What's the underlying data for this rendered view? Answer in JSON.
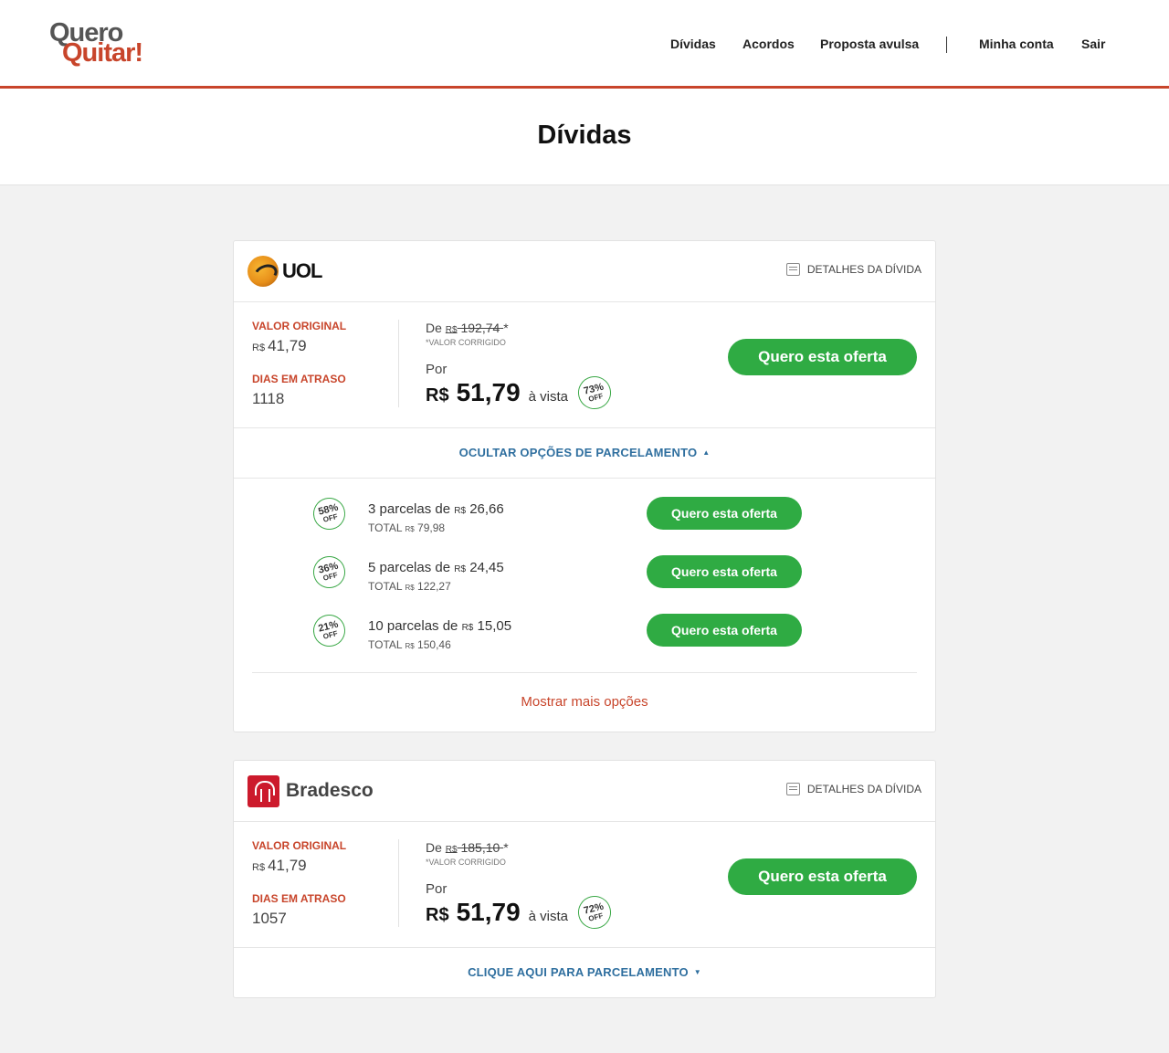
{
  "header": {
    "logo_line1": "Quero",
    "logo_line2": "Quitar!",
    "nav": [
      "Dívidas",
      "Acordos",
      "Proposta avulsa",
      "Minha conta",
      "Sair"
    ]
  },
  "page": {
    "title": "Dívidas"
  },
  "colors": {
    "accent": "#c8452b",
    "green": "#2fab43",
    "link_blue": "#2f6f9f"
  },
  "cards": [
    {
      "brand": "UOL",
      "brand_icon": "uol-logo-icon",
      "details_label": "DETALHES DA DÍVIDA",
      "valor_original_label": "VALOR ORIGINAL",
      "currency": "R$",
      "valor_original": "41,79",
      "dias_atraso_label": "DIAS EM ATRASO",
      "dias_atraso": "1118",
      "de_label": "De",
      "de_value": "192,74",
      "de_mark": "*",
      "corrigido_label": "*VALOR CORRIGIDO",
      "por_label": "Por",
      "price_currency": "R$",
      "price": "51,79",
      "vista_label": "à vista",
      "discount_pct": "73%",
      "off_label": "OFF",
      "cta_label": "Quero esta oferta",
      "toggle_label": "OCULTAR OPÇÕES DE PARCELAMENTO",
      "toggle_icon": "triangle-up-icon",
      "installments": [
        {
          "pct": "58%",
          "off": "OFF",
          "count_text": "3 parcelas de",
          "cur": "R$",
          "amount": "26,66",
          "total_label": "TOTAL",
          "total": "79,98",
          "cta": "Quero esta oferta"
        },
        {
          "pct": "36%",
          "off": "OFF",
          "count_text": "5 parcelas de",
          "cur": "R$",
          "amount": "24,45",
          "total_label": "TOTAL",
          "total": "122,27",
          "cta": "Quero esta oferta"
        },
        {
          "pct": "21%",
          "off": "OFF",
          "count_text": "10 parcelas de",
          "cur": "R$",
          "amount": "15,05",
          "total_label": "TOTAL",
          "total": "150,46",
          "cta": "Quero esta oferta"
        }
      ],
      "more_label": "Mostrar mais opções"
    },
    {
      "brand": "Bradesco",
      "brand_icon": "bradesco-logo-icon",
      "details_label": "DETALHES DA DÍVIDA",
      "valor_original_label": "VALOR ORIGINAL",
      "currency": "R$",
      "valor_original": "41,79",
      "dias_atraso_label": "DIAS EM ATRASO",
      "dias_atraso": "1057",
      "de_label": "De",
      "de_value": "185,10",
      "de_mark": "*",
      "corrigido_label": "*VALOR CORRIGIDO",
      "por_label": "Por",
      "price_currency": "R$",
      "price": "51,79",
      "vista_label": "à vista",
      "discount_pct": "72%",
      "off_label": "OFF",
      "cta_label": "Quero esta oferta",
      "toggle_label": "CLIQUE AQUI PARA PARCELAMENTO",
      "toggle_icon": "triangle-down-icon"
    }
  ]
}
